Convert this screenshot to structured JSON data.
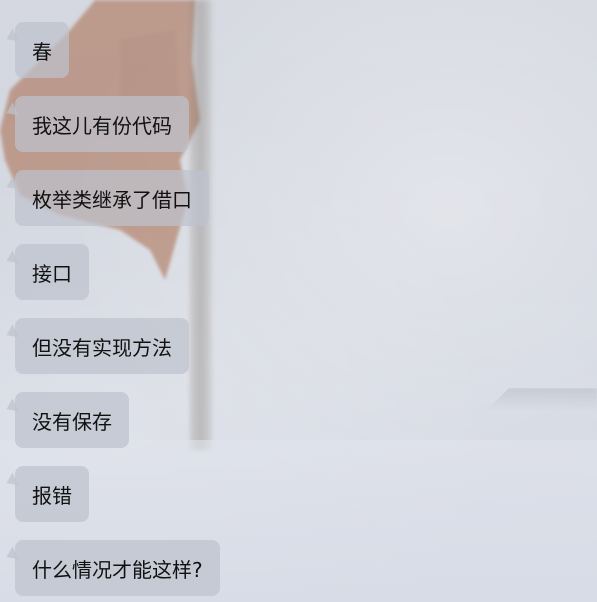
{
  "messages": [
    {
      "text": "春"
    },
    {
      "text": "我这儿有份代码"
    },
    {
      "text": "枚举类继承了借口"
    },
    {
      "text": "接口"
    },
    {
      "text": "但没有实现方法"
    },
    {
      "text": "没有保存"
    },
    {
      "text": "报错"
    },
    {
      "text": "什么情况才能这样?"
    }
  ],
  "colors": {
    "bubble": "#bec2cd",
    "text": "#111111",
    "background": "#d5d8e0"
  }
}
